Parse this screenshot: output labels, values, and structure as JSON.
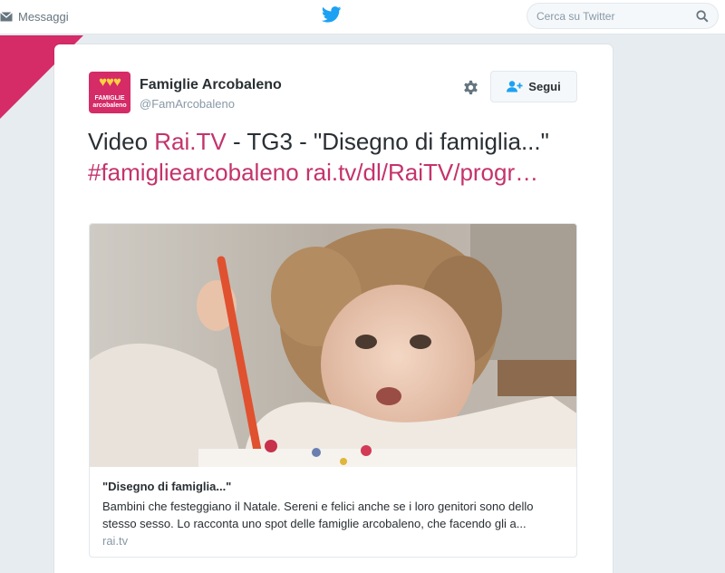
{
  "topbar": {
    "messages_label": "Messaggi",
    "search_placeholder": "Cerca su Twitter"
  },
  "colors": {
    "accent": "#d52b67",
    "link": "#c4336c",
    "twitter_blue": "#1da1f2"
  },
  "icons": {
    "messages": "envelope-icon",
    "logo": "twitter-bird-icon",
    "search": "search-icon",
    "settings": "gear-icon",
    "follow": "add-user-icon"
  },
  "tweet": {
    "avatar_text_1": "FAMIGLIE",
    "avatar_text_2": "arcobaleno",
    "author_name": "Famiglie Arcobaleno",
    "author_handle": "@FamArcobaleno",
    "follow_label": "Segui",
    "text_prefix": "Video ",
    "text_link1": "Rai.TV",
    "text_mid": " - TG3 - \"Disegno di famiglia...\" ",
    "text_hashtag": "#famigliearcobaleno",
    "text_sep": " ",
    "text_url": "rai.tv/dl/RaiTV/progr…"
  },
  "card": {
    "title": "\"Disegno di famiglia...\"",
    "description": "Bambini che festeggiano il Natale. Sereni e felici anche se i loro genitori sono dello stesso sesso. Lo racconta uno spot delle famiglie arcobaleno, che facendo gli a...",
    "domain": "rai.tv"
  }
}
